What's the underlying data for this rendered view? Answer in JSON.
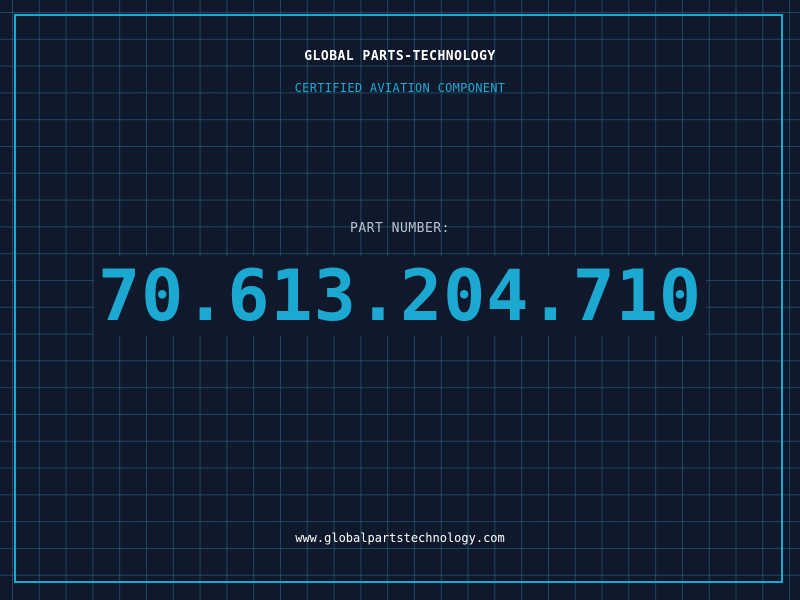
{
  "header": {
    "company": "GLOBAL PARTS-TECHNOLOGY",
    "tagline": "CERTIFIED AVIATION COMPONENT"
  },
  "part": {
    "label": "PART NUMBER:",
    "number": "70.613.204.710"
  },
  "footer": {
    "url": "www.globalpartstechnology.com"
  },
  "colors": {
    "background": "#10182b",
    "grid": "#286e8c",
    "accent": "#1ba9d2",
    "label": "#b7c3d2",
    "text": "#ffffff"
  }
}
